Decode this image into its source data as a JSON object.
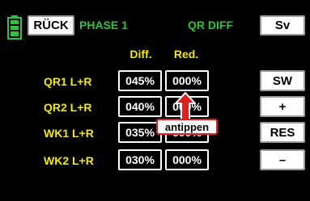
{
  "header": {
    "back_label": "RÜCK",
    "phase": "PHASE 1",
    "title": "QR DIFF",
    "save_label": "Sv"
  },
  "columns": {
    "diff": "Diff.",
    "red": "Red."
  },
  "rows": [
    {
      "label": "QR1 L+R",
      "diff": "045%",
      "red": "000%"
    },
    {
      "label": "QR2 L+R",
      "diff": "040%",
      "red": "000%"
    },
    {
      "label": "WK1 L+R",
      "diff": "035%",
      "red": "000%"
    },
    {
      "label": "WK2 L+R",
      "diff": "030%",
      "red": "000%"
    }
  ],
  "side_buttons": {
    "sw": "SW",
    "plus": "+",
    "res": "RES",
    "minus": "–"
  },
  "callout": {
    "text": "antippen"
  },
  "colors": {
    "background": "#000000",
    "label_yellow": "#f3ea00",
    "title_green": "#2ec43c",
    "callout_red": "#e01f1f",
    "battery_green": "#2ec43c"
  },
  "icons": {
    "battery": "battery-icon",
    "arrow": "arrow-up-icon"
  }
}
